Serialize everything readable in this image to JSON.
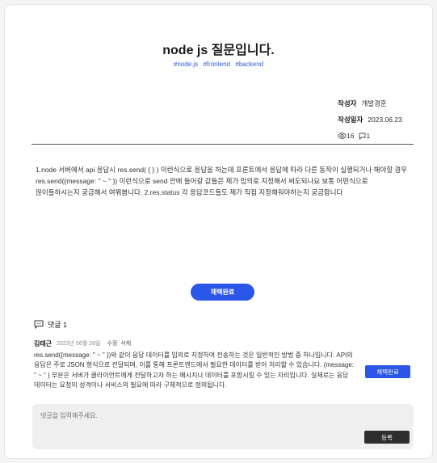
{
  "post": {
    "title": "node js 질문입니다.",
    "tags": [
      "#node.js",
      "#frontend",
      "#backend"
    ],
    "author_label": "작성자",
    "author": "개발경훈",
    "date_label": "작성일자",
    "date": "2023.06.23",
    "views": "16",
    "comments": "1",
    "body": "1.node 서버에서 api 응답시 res.send( { } ) 이런식으로 응답을 하는데 프론트에서 응답에 따라 다른 동작이 실행되거나 해야할 경우 res.send({message: \" ~ \" }) 이런식으로 send 안에 들어갈 값들은 제가 임의로 지정해서 써도되나요 보통 어떤식으로 많이들하시는지 궁금해서 여쭤봅니다. 2.res.status 각 응답코드들도 제가 직접 지정해줘야하는지 궁금합니다",
    "adopt_label": "채택완료"
  },
  "comments_section": {
    "header": "댓글 1",
    "items": [
      {
        "author": "김태근",
        "date": "2023년 06월 28일",
        "edit_label": "수정",
        "delete_label": "삭제",
        "text": "res.send({message: \" ~ \" })와 같이 응답 데이터를 임의로 지정하여 전송하는 것은 일반적인 방법 중 하나입니다. API의 응답은 주로 JSON 형식으로 전달되며, 이를 통해 프론트엔드에서 필요한 데이터를 받아 처리할 수 있습니다. {message: \" ~ \" } 부분은 서버가 클라이언트에게 전달하고자 하는 메시지나 데이터를 포함시킬 수 있는 자리입니다. 실제로는 응답 데이터는 요청의 성격이나 서비스의 필요에 따라 구체적으로 정의됩니다.",
        "adopt_label": "채택완료"
      }
    ],
    "reply_placeholder": "댓글을 입력해주세요.",
    "submit_label": "등록"
  },
  "colors": {
    "accent": "#2b56e8",
    "tag": "#2f5bdb",
    "submit": "#2e2e2e"
  }
}
